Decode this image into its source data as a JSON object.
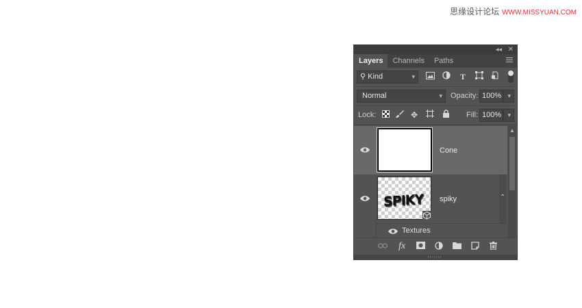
{
  "watermark": {
    "text": "思缘设计论坛",
    "site": "WWW.MISSYUAN.COM"
  },
  "panel": {
    "tabs": [
      {
        "label": "Layers",
        "active": true
      },
      {
        "label": "Channels",
        "active": false
      },
      {
        "label": "Paths",
        "active": false
      }
    ],
    "filter": {
      "kind_label": "Kind"
    },
    "blend": {
      "mode": "Normal",
      "opacity_label": "Opacity:",
      "opacity_value": "100%"
    },
    "lock": {
      "label": "Lock:",
      "fill_label": "Fill:",
      "fill_value": "100%"
    },
    "layers": [
      {
        "name": "Cone",
        "selected": true,
        "visible": true
      },
      {
        "name": "spiky",
        "selected": false,
        "visible": true,
        "thumb_text": "SPIKY",
        "sub": "Textures"
      }
    ],
    "bottom": {
      "fx_label": "fx"
    }
  },
  "colors": {
    "panel_bg": "#535353",
    "selected_layer": "#696969",
    "tab_bar": "#424242"
  }
}
